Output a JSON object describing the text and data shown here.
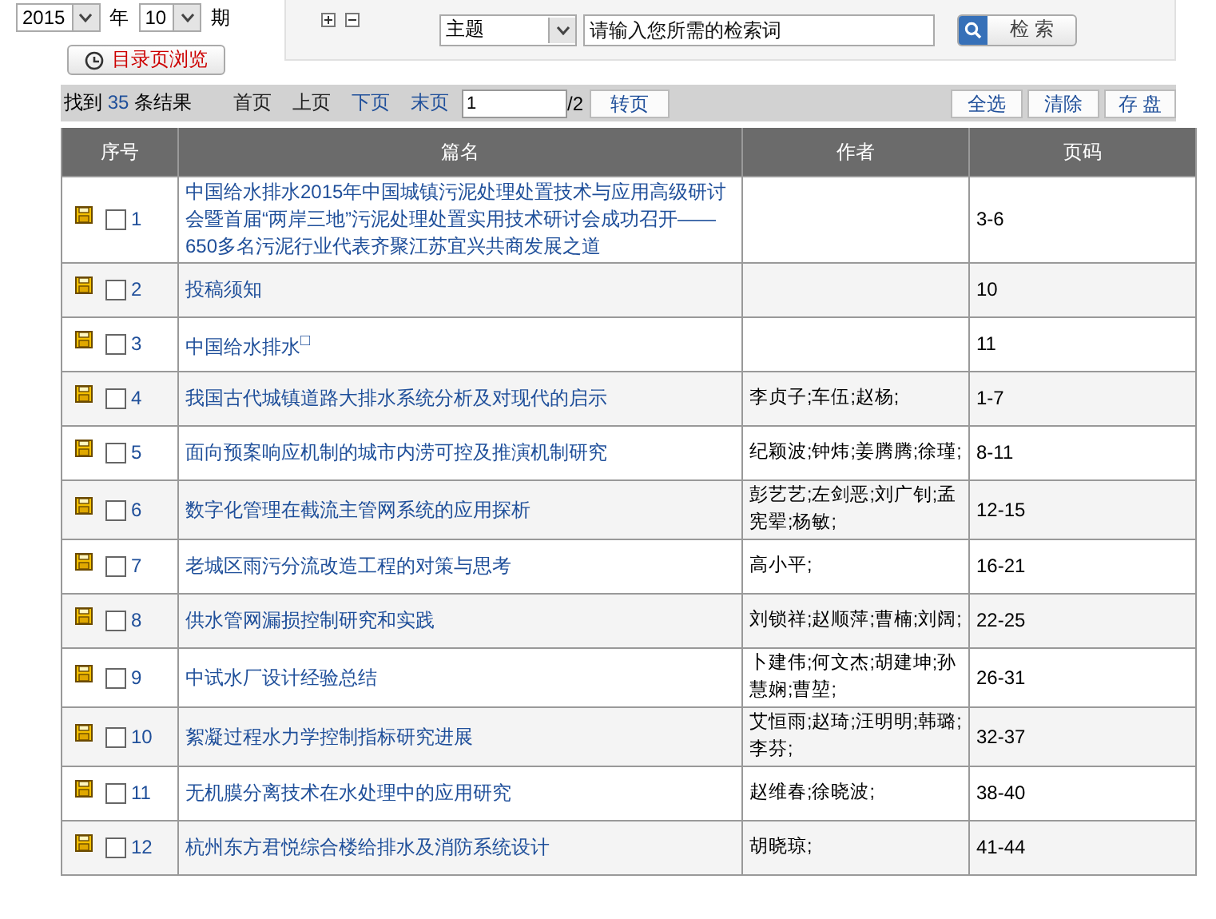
{
  "filters": {
    "year": "2015",
    "year_label": "年",
    "issue": "10",
    "issue_label": "期",
    "toc_button": "目录页浏览"
  },
  "search": {
    "field": "主题",
    "placeholder": "请输入您所需的检索词",
    "button": "检 索"
  },
  "results": {
    "prefix": "找到",
    "count": "35",
    "suffix": "条结果",
    "pager": [
      {
        "label": "首页",
        "disabled": true
      },
      {
        "label": "上页",
        "disabled": true
      },
      {
        "label": "下页",
        "disabled": false
      },
      {
        "label": "末页",
        "disabled": false
      }
    ],
    "page_value": "1",
    "page_total": "/2",
    "go_button": "转页",
    "actions": [
      "全选",
      "清除",
      "存 盘"
    ]
  },
  "table": {
    "columns": [
      "序号",
      "篇名",
      "作者",
      "页码"
    ],
    "rows": [
      {
        "no": "1",
        "checked": false,
        "title": "中国给水排水2015年中国城镇污泥处理处置技术与应用高级研讨会暨首届“两岸三地”污泥处理处置实用技术研讨会成功召开——650多名污泥行业代表齐聚江苏宜兴共商发展之道",
        "authors": "",
        "pages": "3-6"
      },
      {
        "no": "2",
        "checked": false,
        "title": "投稿须知",
        "authors": "",
        "pages": "10"
      },
      {
        "no": "3",
        "checked": false,
        "title": "中国给水排水$^{□}$",
        "authors": "",
        "pages": "11"
      },
      {
        "no": "4",
        "checked": false,
        "title": "我国古代城镇道路大排水系统分析及对现代的启示",
        "authors": "李贞子;车伍;赵杨;",
        "pages": "1-7"
      },
      {
        "no": "5",
        "checked": false,
        "title": "面向预案响应机制的城市内涝可控及推演机制研究",
        "authors": "纪颖波;钟炜;姜腾腾;徐瑾;",
        "pages": "8-11"
      },
      {
        "no": "6",
        "checked": false,
        "title": "数字化管理在截流主管网系统的应用探析",
        "authors": "彭艺艺;左剑恶;刘广钊;孟宪翚;杨敏;",
        "pages": "12-15"
      },
      {
        "no": "7",
        "checked": false,
        "title": "老城区雨污分流改造工程的对策与思考",
        "authors": "高小平;",
        "pages": "16-21"
      },
      {
        "no": "8",
        "checked": false,
        "title": "供水管网漏损控制研究和实践",
        "authors": "刘锁祥;赵顺萍;曹楠;刘阔;",
        "pages": "22-25"
      },
      {
        "no": "9",
        "checked": false,
        "title": "中试水厂设计经验总结",
        "authors": "卜建伟;何文杰;胡建坤;孙慧娴;曹堃;",
        "pages": "26-31"
      },
      {
        "no": "10",
        "checked": false,
        "title": "絮凝过程水力学控制指标研究进展",
        "authors": "艾恒雨;赵琦;汪明明;韩璐;李芬;",
        "pages": "32-37"
      },
      {
        "no": "11",
        "checked": false,
        "title": "无机膜分离技术在水处理中的应用研究",
        "authors": "赵维春;徐晓波;",
        "pages": "38-40"
      },
      {
        "no": "12",
        "checked": false,
        "title": "杭州东方君悦综合楼给排水及消防系统设计",
        "authors": "胡晓琼;",
        "pages": "41-44"
      }
    ]
  }
}
